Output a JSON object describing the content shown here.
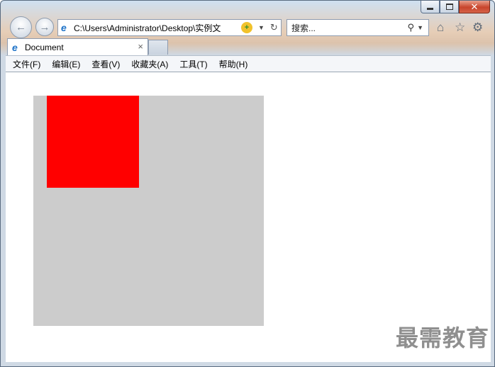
{
  "browser": {
    "address": "C:\\Users\\Administrator\\Desktop\\实例文",
    "search_placeholder": "搜索...",
    "tab_title": "Document",
    "tab_close": "×"
  },
  "menu": [
    "文件(F)",
    "编辑(E)",
    "查看(V)",
    "收藏夹(A)",
    "工具(T)",
    "帮助(H)"
  ],
  "page": {
    "outer_box_color": "#cccccc",
    "inner_box_color": "#ff0000"
  },
  "watermark": "最需教育",
  "icons": {
    "back": "back-arrow-icon",
    "forward": "forward-arrow-icon",
    "home": "home-icon",
    "favorites": "star-icon",
    "tools": "gear-icon",
    "search": "search-icon",
    "refresh": "refresh-icon",
    "compat": "compatibility-view-icon"
  }
}
